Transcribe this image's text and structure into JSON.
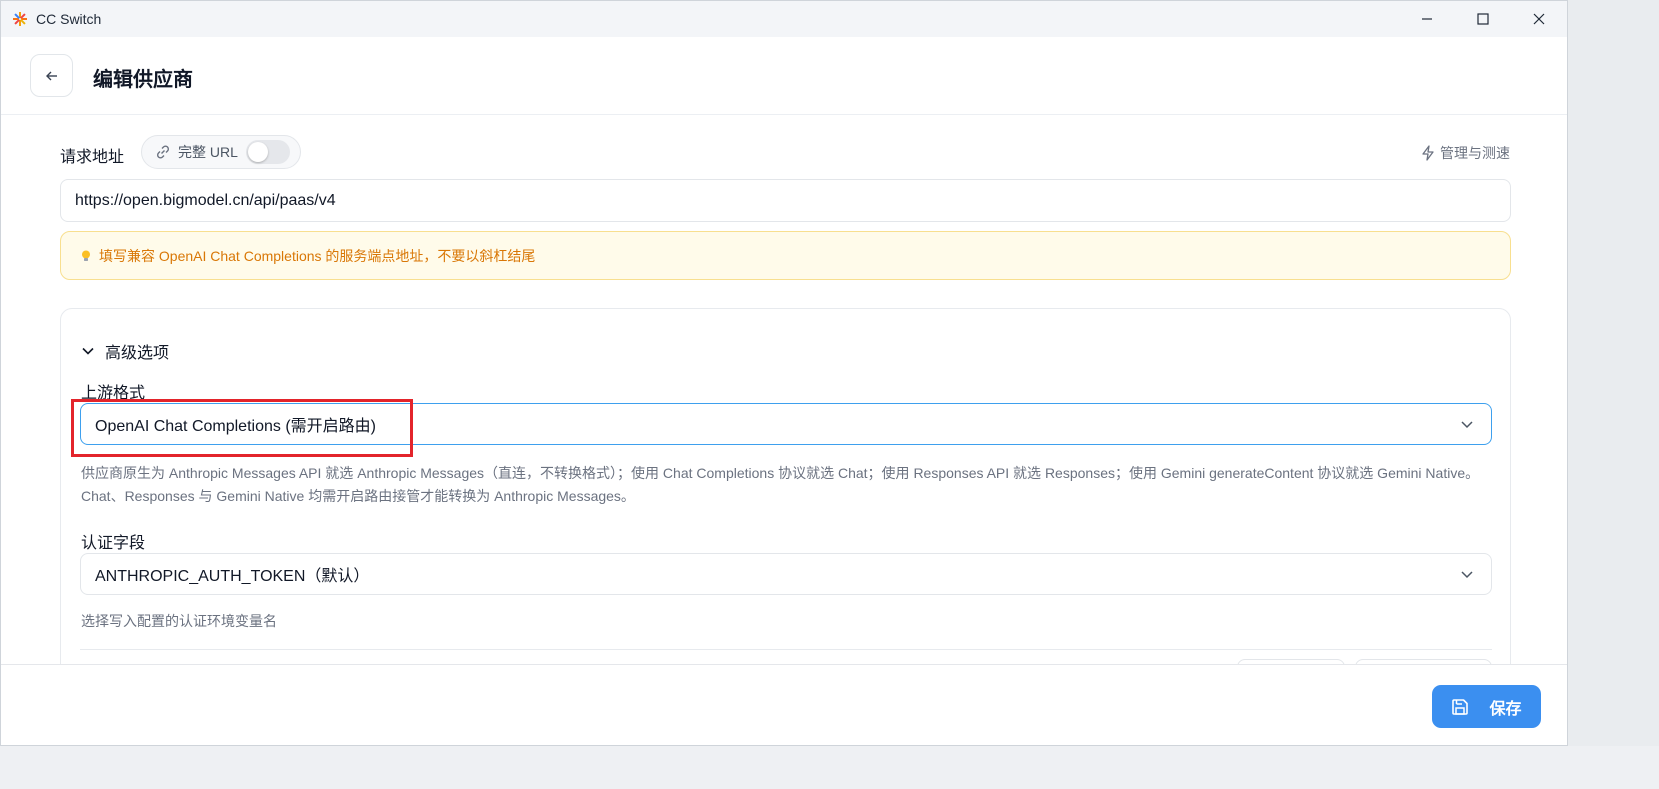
{
  "app": {
    "title": "CC Switch"
  },
  "header": {
    "title": "编辑供应商"
  },
  "request": {
    "label": "请求地址",
    "full_url_label": "完整 URL",
    "full_url_enabled": false,
    "manage_label": "管理与测速",
    "url_value": "https://open.bigmodel.cn/api/paas/v4",
    "hint": "填写兼容 OpenAI Chat Completions 的服务端点地址，不要以斜杠结尾"
  },
  "advanced": {
    "title": "高级选项",
    "upstream_label": "上游格式",
    "upstream_value": "OpenAI Chat Completions (需开启路由)",
    "upstream_help_1": "供应商原生为 Anthropic Messages API 就选 Anthropic Messages（直连，不转换格式）；使用 Chat Completions 协议就选 Chat；使用 Responses API 就选 Responses；使用 Gemini generateContent 协议就选 Gemini Native。",
    "upstream_help_2": "Chat、Responses 与 Gemini Native 均需开启路由接管才能转换为 Anthropic Messages。",
    "auth_label": "认证字段",
    "auth_value": "ANTHROPIC_AUTH_TOKEN（默认）",
    "auth_help": "选择写入配置的认证环境变量名"
  },
  "footer": {
    "save_label": "保存"
  },
  "colors": {
    "accent": "#3b8ff0",
    "highlight": "#e3242b",
    "hint_text": "#d97706"
  }
}
